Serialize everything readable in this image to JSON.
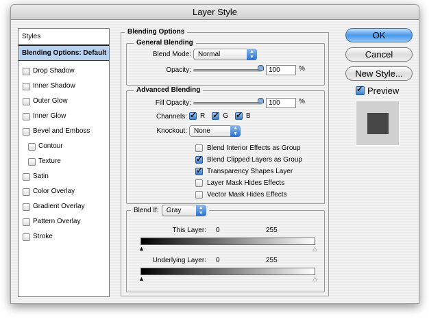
{
  "window": {
    "title": "Layer Style"
  },
  "sidebar": {
    "header": "Styles",
    "selected": "Blending Options: Default",
    "items": [
      {
        "label": "Drop Shadow",
        "checked": false
      },
      {
        "label": "Inner Shadow",
        "checked": false
      },
      {
        "label": "Outer Glow",
        "checked": false
      },
      {
        "label": "Inner Glow",
        "checked": false
      },
      {
        "label": "Bevel and Emboss",
        "checked": false
      },
      {
        "label": "Contour",
        "checked": false
      },
      {
        "label": "Texture",
        "checked": false
      },
      {
        "label": "Satin",
        "checked": false
      },
      {
        "label": "Color Overlay",
        "checked": false
      },
      {
        "label": "Gradient Overlay",
        "checked": false
      },
      {
        "label": "Pattern Overlay",
        "checked": false
      },
      {
        "label": "Stroke",
        "checked": false
      }
    ]
  },
  "blending": {
    "title": "Blending Options",
    "general": {
      "title": "General Blending",
      "blend_mode_label": "Blend Mode:",
      "blend_mode": "Normal",
      "opacity_label": "Opacity:",
      "opacity": "100",
      "percent": "%"
    },
    "advanced": {
      "title": "Advanced Blending",
      "fill_label": "Fill Opacity:",
      "fill": "100",
      "percent": "%",
      "channels_label": "Channels:",
      "channels": [
        "R",
        "G",
        "B"
      ],
      "knockout_label": "Knockout:",
      "knockout": "None",
      "options": [
        {
          "label": "Blend Interior Effects as Group",
          "checked": false
        },
        {
          "label": "Blend Clipped Layers as Group",
          "checked": true
        },
        {
          "label": "Transparency Shapes Layer",
          "checked": true
        },
        {
          "label": "Layer Mask Hides Effects",
          "checked": false
        },
        {
          "label": "Vector Mask Hides Effects",
          "checked": false
        }
      ]
    },
    "blend_if": {
      "label": "Blend If:",
      "value": "Gray",
      "this_layer": "This Layer:",
      "underlying": "Underlying Layer:",
      "min": "0",
      "max": "255"
    }
  },
  "buttons": {
    "ok": "OK",
    "cancel": "Cancel",
    "new_style": "New Style..."
  },
  "preview": {
    "label": "Preview",
    "checked": true
  }
}
